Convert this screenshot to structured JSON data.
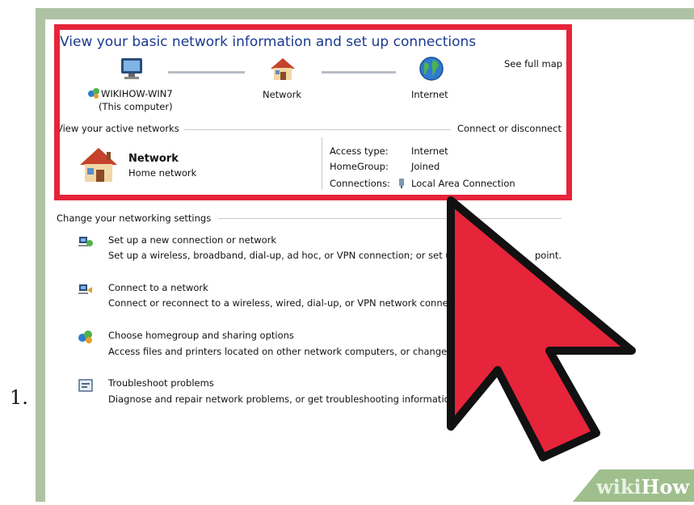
{
  "list_number": "1.",
  "map": {
    "title": "View your basic network information and set up connections",
    "see_full_map": "See full map",
    "nodes": [
      {
        "name": "WIKIHOW-WIN7",
        "sub": "(This computer)",
        "icon": "computer-icon"
      },
      {
        "name": "Network",
        "icon": "house-icon"
      },
      {
        "name": "Internet",
        "icon": "globe-icon"
      }
    ]
  },
  "active": {
    "header": "View your active networks",
    "connect_link": "Connect or disconnect",
    "network_name": "Network",
    "network_type": "Home network",
    "access_label": "Access type:",
    "access_value": "Internet",
    "homegroup_label": "HomeGroup:",
    "homegroup_value": "Joined",
    "connections_label": "Connections:",
    "connections_value": "Local Area Connection"
  },
  "settings": {
    "header": "Change your networking settings",
    "items": [
      {
        "title": "Set up a new connection or network",
        "desc": "Set up a wireless, broadband, dial-up, ad hoc, or VPN connection; or set up",
        "tail": "point.",
        "icon": "new-connection-icon"
      },
      {
        "title": "Connect to a network",
        "desc": "Connect or reconnect to a wireless, wired, dial-up, or VPN network connect",
        "icon": "connect-network-icon"
      },
      {
        "title": "Choose homegroup and sharing options",
        "desc": "Access files and printers located on other network computers, or change sh",
        "icon": "homegroup-icon"
      },
      {
        "title": "Troubleshoot problems",
        "desc": "Diagnose and repair network problems, or get troubleshooting information",
        "icon": "troubleshoot-icon"
      }
    ]
  },
  "watermark": {
    "part1": "wiki",
    "part2": "How"
  },
  "colors": {
    "highlight_border": "#e6243a",
    "link": "#1e5bb8",
    "cursor": "#e6243a",
    "cursor_outline": "#111111"
  }
}
